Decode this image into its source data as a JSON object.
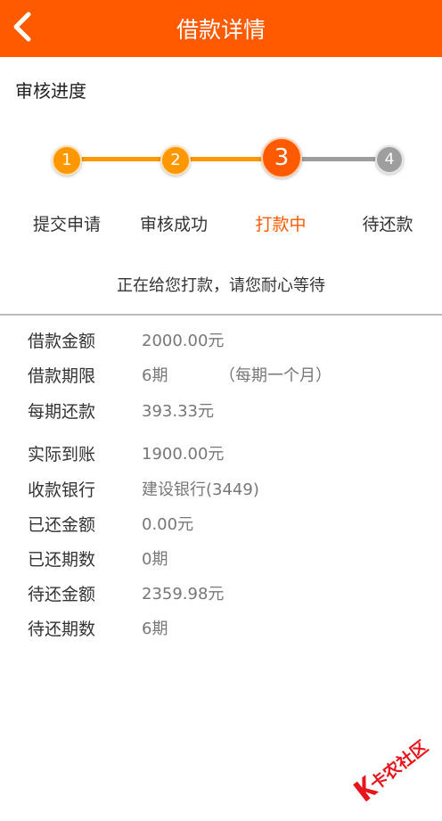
{
  "header": {
    "title": "借款详情",
    "back_icon": "chevron-left-icon"
  },
  "progress": {
    "title": "审核进度",
    "steps": [
      {
        "number": "1",
        "label": "提交申请",
        "state": "done"
      },
      {
        "number": "2",
        "label": "审核成功",
        "state": "done"
      },
      {
        "number": "3",
        "label": "打款中",
        "state": "current"
      },
      {
        "number": "4",
        "label": "待还款",
        "state": "pending"
      }
    ],
    "message": "正在给您打款，请您耐心等待"
  },
  "details": {
    "loan_amount": {
      "label": "借款金额",
      "value": "2000.00元"
    },
    "term": {
      "label": "借款期限",
      "value": "6期",
      "note": "（每期一个月）"
    },
    "installment": {
      "label": "每期还款",
      "value": "393.33元"
    },
    "received": {
      "label": "实际到账",
      "value": "1900.00元"
    },
    "bank": {
      "label": "收款银行",
      "value": "建设银行(3449)"
    },
    "repaid_amount": {
      "label": "已还金额",
      "value": "0.00元"
    },
    "repaid_periods": {
      "label": "已还期数",
      "value": "0期"
    },
    "remaining_amount": {
      "label": "待还金额",
      "value": "2359.98元"
    },
    "remaining_periods": {
      "label": "待还期数",
      "value": "6期"
    }
  },
  "watermark": {
    "text": "卡农社区"
  },
  "colors": {
    "brand": "#ff5a00",
    "done": "#ff9800",
    "current": "#ff5a00",
    "pending": "#9e9e9e"
  }
}
